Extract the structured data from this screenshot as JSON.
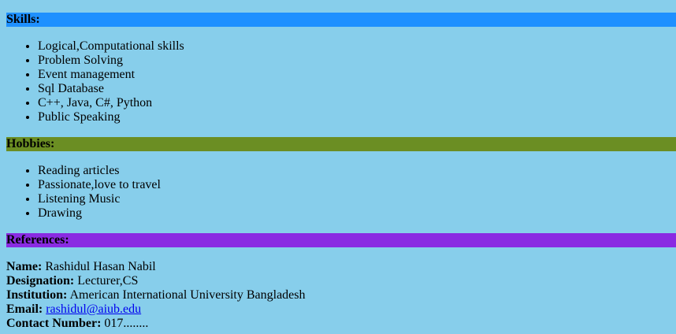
{
  "colors": {
    "page_background": "#87CEEB",
    "skills_header_bg": "#1E90FF",
    "hobbies_header_bg": "#6B8E23",
    "references_header_bg": "#8A2BE2",
    "link": "#0000EE"
  },
  "skills": {
    "title": "Skills:",
    "items": [
      "Logical,Computational skills",
      "Problem Solving",
      "Event management",
      "Sql Database",
      "C++, Java, C#, Python",
      "Public Speaking"
    ]
  },
  "hobbies": {
    "title": "Hobbies:",
    "items": [
      "Reading articles",
      "Passionate,love to travel",
      "Listening Music",
      "Drawing"
    ]
  },
  "references": {
    "title": "References:",
    "name_label": "Name:",
    "name_value": " Rashidul Hasan Nabil",
    "designation_label": "Designation:",
    "designation_value": " Lecturer,CS",
    "institution_label": "Institution:",
    "institution_value": " American International University Bangladesh",
    "email_label": "Email:",
    "email_value": "rashidul@aiub.edu",
    "contact_label": "Contact Number:",
    "contact_value": " 017........"
  }
}
